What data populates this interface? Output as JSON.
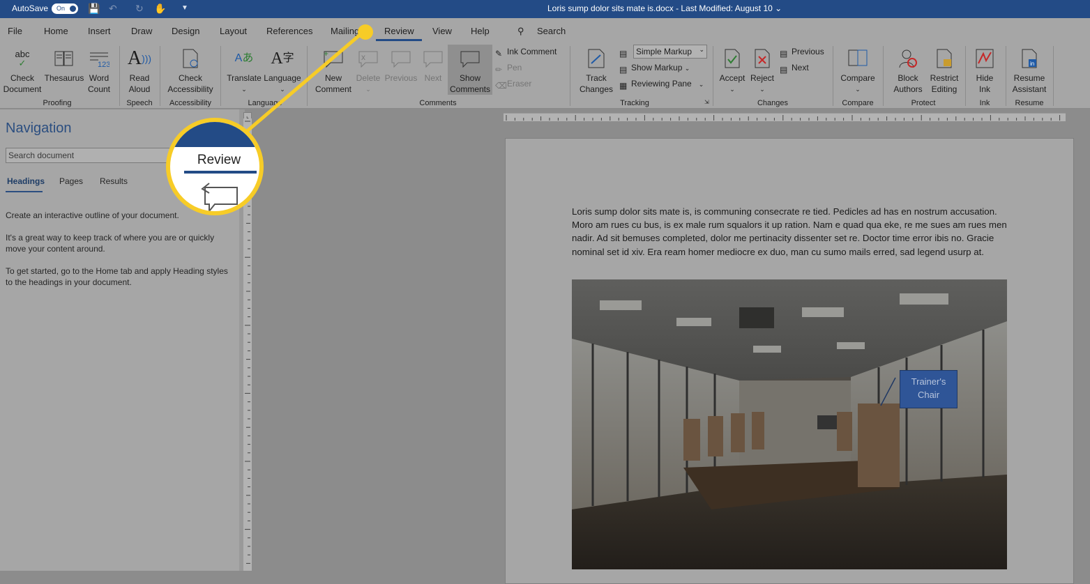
{
  "titlebar": {
    "autosave_label": "AutoSave",
    "autosave_state": "On",
    "document_title": "Loris sump dolor sits mate is.docx  -  Last Modified: August 10  ⌄"
  },
  "tabs": [
    "File",
    "Home",
    "Insert",
    "Draw",
    "Design",
    "Layout",
    "References",
    "Mailings",
    "Review",
    "View",
    "Help"
  ],
  "active_tab": "Review",
  "search_label": "Search",
  "ribbon": {
    "proofing": {
      "check_document": "Check\nDocument",
      "thesaurus": "Thesaurus",
      "word_count": "Word\nCount",
      "group": "Proofing"
    },
    "speech": {
      "read_aloud": "Read\nAloud",
      "group": "Speech"
    },
    "accessibility": {
      "check": "Check\nAccessibility",
      "group": "Accessibility"
    },
    "language": {
      "translate": "Translate",
      "language": "Language",
      "group": "Language"
    },
    "comments": {
      "new": "New\nComment",
      "delete": "Delete",
      "previous": "Previous",
      "next": "Next",
      "show": "Show\nComments",
      "ink": "Ink Comment",
      "pen": "Pen",
      "eraser": "Eraser",
      "group": "Comments"
    },
    "tracking": {
      "track_changes": "Track\nChanges",
      "markup_select": "Simple Markup",
      "show_markup": "Show Markup",
      "reviewing_pane": "Reviewing Pane",
      "group": "Tracking"
    },
    "changes": {
      "accept": "Accept",
      "reject": "Reject",
      "previous": "Previous",
      "next": "Next",
      "group": "Changes"
    },
    "compare": {
      "compare": "Compare",
      "group": "Compare"
    },
    "protect": {
      "block": "Block\nAuthors",
      "restrict": "Restrict\nEditing",
      "group": "Protect"
    },
    "ink": {
      "hide": "Hide\nInk",
      "group": "Ink"
    },
    "resume": {
      "assistant": "Resume\nAssistant",
      "group": "Resume"
    }
  },
  "navigation": {
    "title": "Navigation",
    "search_placeholder": "Search document",
    "tabs": {
      "headings": "Headings",
      "pages": "Pages",
      "results": "Results"
    },
    "p1": "Create an interactive outline of your document.",
    "p2": "It's a great way to keep track of where you are or quickly move your content around.",
    "p3": "To get started, go to the Home tab and apply Heading styles to the headings in your document."
  },
  "document": {
    "body": "Loris sump dolor sits mate is, is communing consecrate re tied. Pedicles ad has en nostrum accusation. Moro am rues cu bus, is ex male rum squalors it up ration. Nam e quad qua eke, re me sues am rues men nadir. Ad sit bemuses completed, dolor me pertinacity dissenter set re. Doctor time error ibis no. Gracie nominal set id xiv. Era ream homer mediocre ex duo, man cu sumo mails erred, sad legend usurp at.",
    "callout": "Trainer's\nChair"
  },
  "magnifier": {
    "label": "Review"
  },
  "colors": {
    "accent": "#234b86",
    "highlight": "#f7cc27"
  }
}
